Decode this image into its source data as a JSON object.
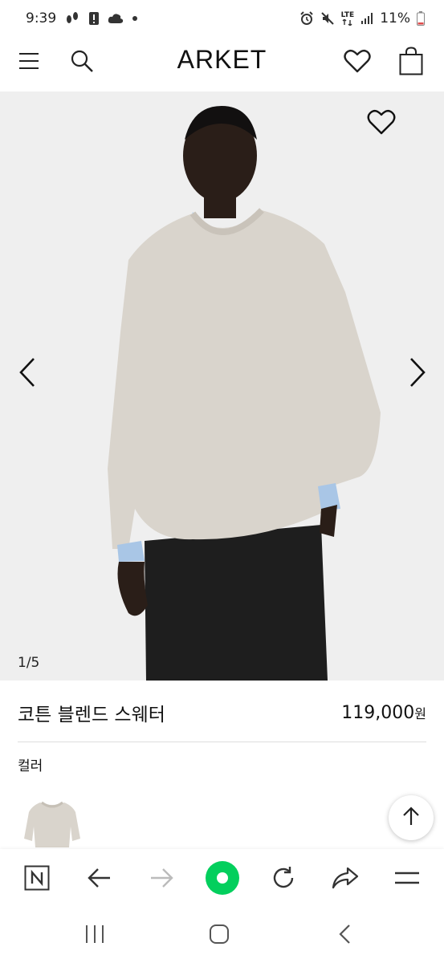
{
  "status_bar": {
    "time": "9:39",
    "network": "LTE",
    "battery": "11%",
    "icons": [
      "step-counter-icon",
      "alert-icon",
      "cloud-icon",
      "dot-icon",
      "alarm-icon",
      "mute-icon",
      "lte-icon",
      "signal-icon",
      "battery-icon"
    ]
  },
  "header": {
    "brand": "ARKET",
    "icons": [
      "menu-icon",
      "search-icon",
      "heart-icon",
      "bag-icon"
    ]
  },
  "hero": {
    "counter": "1/5",
    "current_slide": 1,
    "total_slides": 5,
    "icons": [
      "heart-icon",
      "chevron-left-icon",
      "chevron-right-icon"
    ]
  },
  "product": {
    "name": "코튼 블렌드 스웨터",
    "price": "119,000",
    "currency": "원",
    "color_label": "컬러"
  },
  "browser_toolbar": {
    "icons": [
      "naver-icon",
      "back-icon",
      "forward-icon",
      "green-dot-icon",
      "reload-icon",
      "share-icon",
      "more-icon"
    ],
    "accent": "#03cf5d"
  },
  "android_nav": {
    "icons": [
      "recents-icon",
      "home-icon",
      "back-icon"
    ]
  },
  "colors": {
    "hero_bg": "#efefef",
    "sweater": "#d9d4cc",
    "text": "#111111"
  }
}
